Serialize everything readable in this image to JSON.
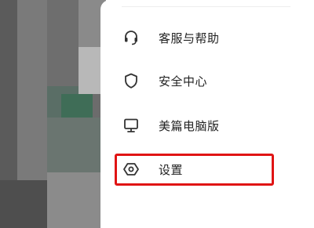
{
  "menu": {
    "items": [
      {
        "label": "客服与帮助",
        "icon": "headset-icon"
      },
      {
        "label": "安全中心",
        "icon": "shield-icon"
      },
      {
        "label": "美篇电脑版",
        "icon": "monitor-icon"
      },
      {
        "label": "设置",
        "icon": "settings-hexagon-icon"
      }
    ],
    "highlighted_index": 3
  },
  "colors": {
    "highlight": "#e01414",
    "text": "#222222",
    "icon": "#333333",
    "backdrop": "#6c6c6c"
  }
}
